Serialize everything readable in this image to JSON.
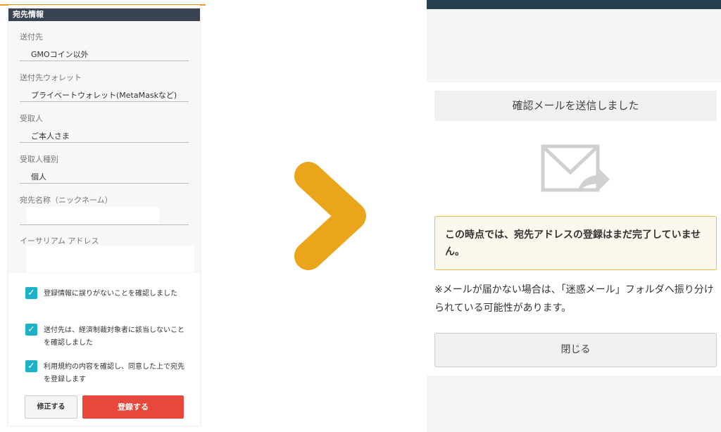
{
  "left": {
    "section_header": "宛先情報",
    "fields": [
      {
        "label": "送付先",
        "value": "GMOコイン以外"
      },
      {
        "label": "送付先ウォレット",
        "value": "プライベートウォレット(MetaMaskなど)"
      },
      {
        "label": "受取人",
        "value": "ご本人さま"
      },
      {
        "label": "受取人種別",
        "value": "個人"
      },
      {
        "label": "宛先名称（ニックネーム）",
        "value": ""
      },
      {
        "label": "イーサリアム アドレス",
        "value": ""
      }
    ],
    "checks": [
      {
        "text": "登録情報に誤りがないことを確認しました",
        "checked": true
      },
      {
        "text": "送付先は、経済制裁対象者に該当しないことを確認しました",
        "checked": true
      },
      {
        "text": "利用規約の内容を確認し、同意した上で宛先を登録します",
        "checked": true
      }
    ],
    "edit_button": "修正する",
    "register_button": "登録する"
  },
  "right": {
    "sent_title": "確認メールを送信しました",
    "notice": "この時点では、宛先アドレスの登録はまだ完了していません。",
    "spam_note": "※メールが届かない場合は、「迷惑メール」フォルダへ振り分けられている可能性があります。",
    "close_button": "閉じる"
  },
  "icons": {
    "arrow": "chevron-right-icon",
    "mail": "mail-forward-icon",
    "check": "checkmark-icon"
  },
  "colors": {
    "header": "#3a4351",
    "accent_orange": "#eba51b",
    "checkbox": "#1fb2c7",
    "register": "#e8473b",
    "top_bar": "#27404e",
    "notice_border": "#f0b84a"
  }
}
